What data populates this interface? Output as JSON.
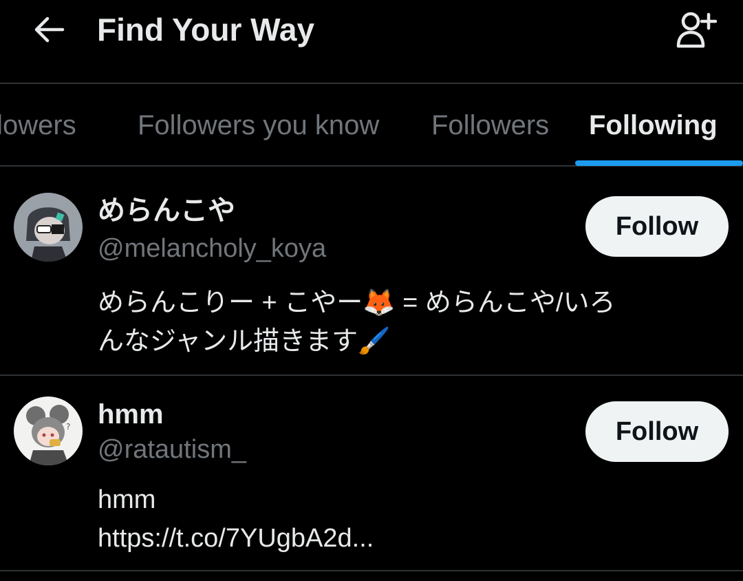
{
  "header": {
    "title": "Find Your Way",
    "back_icon": "arrow-left-icon",
    "add_user_icon": "person-plus-icon"
  },
  "tabs": [
    {
      "label": "ollowers",
      "active": false
    },
    {
      "label": "Followers you know",
      "active": false
    },
    {
      "label": "Followers",
      "active": false
    },
    {
      "label": "Following",
      "active": true
    }
  ],
  "colors": {
    "accent": "#1d9bf0",
    "background": "#000000",
    "primary_text": "#e7e9ea",
    "secondary_text": "#71767b",
    "divider": "#2f3336",
    "button_bg": "#eff3f4"
  },
  "users": [
    {
      "display_name": "めらんこや",
      "handle": "@melancholy_koya",
      "bio_lines": [
        "めらんこりー + こやー🦊 = めらんこや/いろ",
        "んなジャンル描きます🖌️"
      ],
      "follow_label": "Follow"
    },
    {
      "display_name": "hmm",
      "handle": "@ratautism_",
      "bio_lines": [
        "hmm",
        "https://t.co/7YUgbA2d..."
      ],
      "follow_label": "Follow"
    }
  ]
}
